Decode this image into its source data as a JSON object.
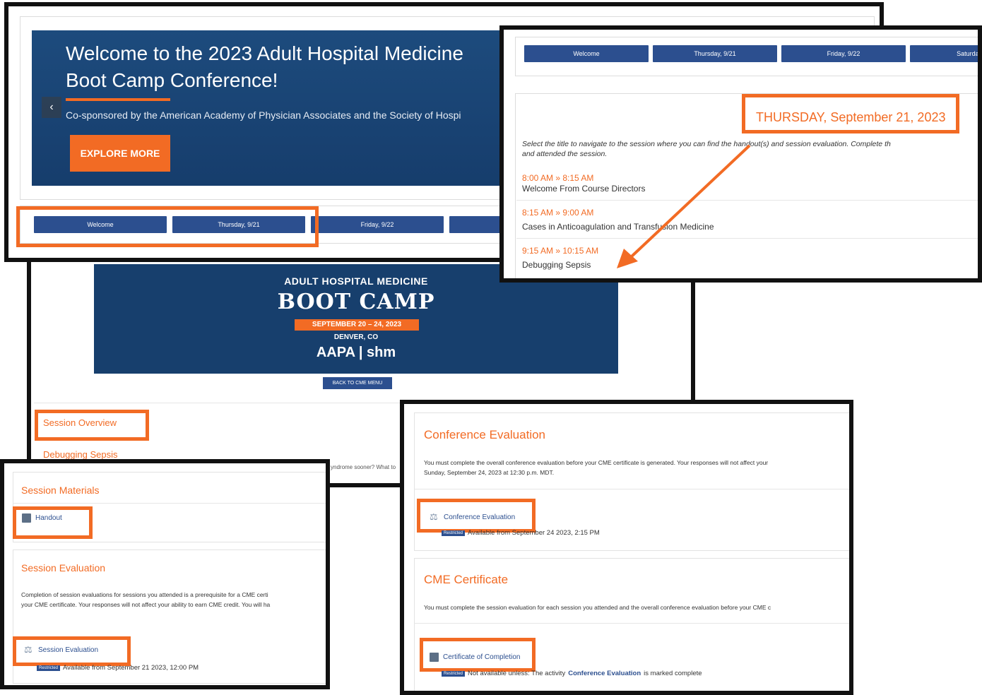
{
  "welcome_panel": {
    "hero_title_line1": "Welcome to the 2023 Adult Hospital Medicine",
    "hero_title_line2": "Boot Camp Conference!",
    "hero_subtitle": "Co-sponsored by the American Academy of Physician Associates and the Society of Hospi",
    "explore_button": "EXPLORE MORE",
    "tabs": [
      "Welcome",
      "Thursday, 9/21",
      "Friday, 9/22",
      "Sat"
    ]
  },
  "thursday_panel": {
    "tabs": [
      "Welcome",
      "Thursday, 9/21",
      "Friday, 9/22",
      "Saturday,"
    ],
    "heading": "THURSDAY, September 21, 2023",
    "instructions_line1": "Select the title to navigate to the session where you can find the handout(s) and session evaluation. Complete th",
    "instructions_line2": "and attended the session.",
    "sessions": [
      {
        "time": "8:00 AM » 8:15 AM",
        "title": "Welcome From Course Directors"
      },
      {
        "time": "8:15 AM » 9:00 AM",
        "title": "Cases in Anticoagulation and Transfusion Medicine"
      },
      {
        "time": "9:15 AM » 10:15 AM",
        "title": "Debugging Sepsis"
      }
    ]
  },
  "bootcamp_panel": {
    "banner_line1": "ADULT HOSPITAL MEDICINE",
    "banner_line2": "BOOT CAMP",
    "banner_dates": "SEPTEMBER 20 – 24, 2023",
    "banner_location": "DENVER, CO",
    "banner_logos": "AAPA | shm",
    "back_button": "BACK TO CME MENU",
    "session_overview": "Session Overview",
    "session_name": "Debugging Sepsis",
    "overflow_text": "yndrome sooner? What to"
  },
  "materials_panel": {
    "materials_heading": "Session Materials",
    "handout_label": "Handout",
    "evaluation_heading": "Session Evaluation",
    "evaluation_text_line1": "Completion of session evaluations for sessions you attended is a prerequisite for a CME certi",
    "evaluation_text_line2": "your CME certificate. Your responses will not affect your ability to earn CME credit. You will ha",
    "evaluation_link": "Session Evaluation",
    "restricted_badge": "Restricted",
    "availability": "Available from September 21 2023, 12:00 PM"
  },
  "conference_panel": {
    "conf_eval_heading": "Conference Evaluation",
    "conf_eval_text_line1": "You must complete the overall conference evaluation before your CME certificate is generated. Your responses will not affect your",
    "conf_eval_text_line2": "Sunday, September 24, 2023 at 12:30 p.m. MDT.",
    "conf_eval_link": "Conference Evaluation",
    "restricted_badge": "Restricted",
    "conf_availability": "Available from September 24 2023, 2:15 PM",
    "cme_heading": "CME Certificate",
    "cme_text": "You must complete the session evaluation for each session you attended and the overall conference evaluation before your CME c",
    "cme_link": "Certificate of Completion",
    "cme_restriction_prefix": "Not available unless: The activity",
    "cme_restriction_activity": "Conference Evaluation",
    "cme_restriction_suffix": "is marked complete"
  },
  "colors": {
    "accent_orange": "#f26b24",
    "button_blue": "#2c4f8f",
    "hero_blue": "#1d4b7d",
    "panel_border": "#111111"
  }
}
